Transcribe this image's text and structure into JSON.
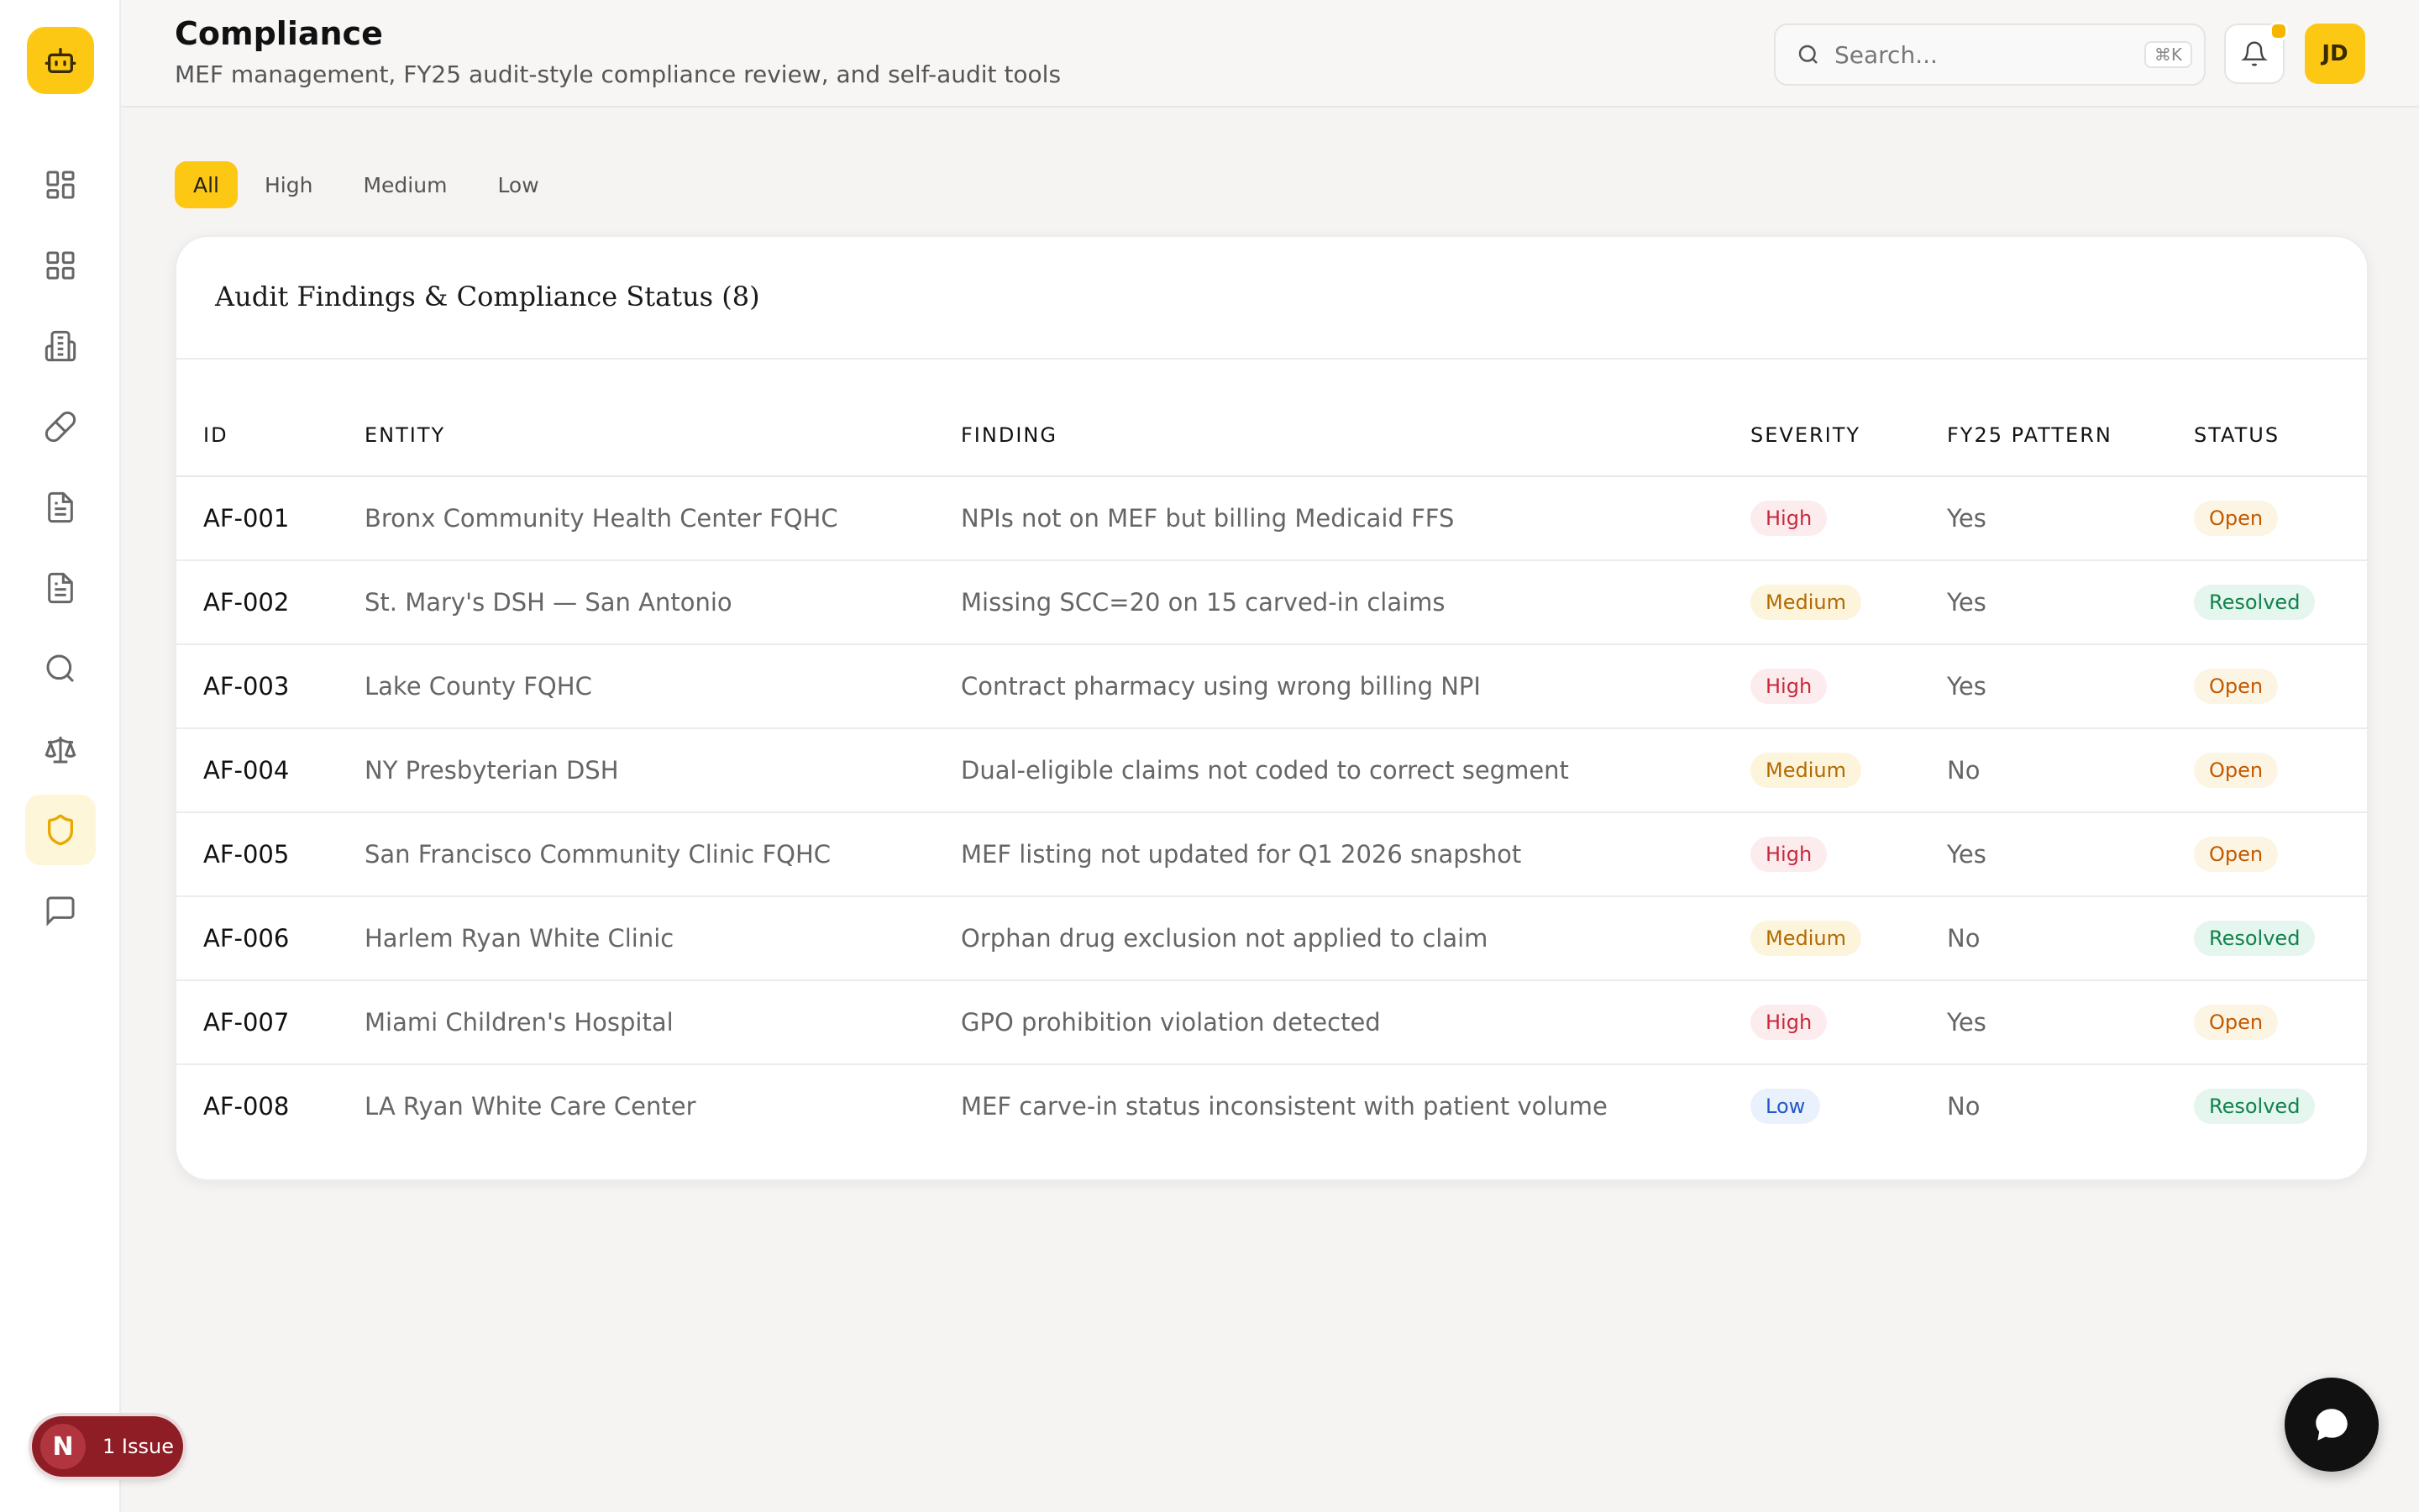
{
  "header": {
    "title": "Compliance",
    "subtitle": "MEF management, FY25 audit-style compliance review, and self-audit tools",
    "search_placeholder": "Search...",
    "search_shortcut": "⌘K",
    "avatar_initials": "JD"
  },
  "sidebar": {
    "logo_icon": "robot-icon",
    "items": [
      {
        "icon": "dashboard-icon",
        "active": false
      },
      {
        "icon": "grid-icon",
        "active": false
      },
      {
        "icon": "building-icon",
        "active": false
      },
      {
        "icon": "pill-icon",
        "active": false
      },
      {
        "icon": "document-icon",
        "active": false
      },
      {
        "icon": "document-icon",
        "active": false
      },
      {
        "icon": "search-icon",
        "active": false
      },
      {
        "icon": "scale-icon",
        "active": false
      },
      {
        "icon": "shield-icon",
        "active": true
      },
      {
        "icon": "chat-icon",
        "active": false
      }
    ]
  },
  "filters": {
    "all": "All",
    "high": "High",
    "medium": "Medium",
    "low": "Low",
    "selected": "All"
  },
  "card": {
    "title": "Audit Findings & Compliance Status (8)"
  },
  "table": {
    "headers": {
      "id": "ID",
      "entity": "ENTITY",
      "finding": "FINDING",
      "severity": "SEVERITY",
      "fy25": "FY25 PATTERN",
      "status": "STATUS"
    },
    "rows": [
      {
        "id": "AF-001",
        "entity": "Bronx Community Health Center FQHC",
        "finding": "NPIs not on MEF but billing Medicaid FFS",
        "severity": "High",
        "fy25": "Yes",
        "status": "Open"
      },
      {
        "id": "AF-002",
        "entity": "St. Mary's DSH — San Antonio",
        "finding": "Missing SCC=20 on 15 carved-in claims",
        "severity": "Medium",
        "fy25": "Yes",
        "status": "Resolved"
      },
      {
        "id": "AF-003",
        "entity": "Lake County FQHC",
        "finding": "Contract pharmacy using wrong billing NPI",
        "severity": "High",
        "fy25": "Yes",
        "status": "Open"
      },
      {
        "id": "AF-004",
        "entity": "NY Presbyterian DSH",
        "finding": "Dual-eligible claims not coded to correct segment",
        "severity": "Medium",
        "fy25": "No",
        "status": "Open"
      },
      {
        "id": "AF-005",
        "entity": "San Francisco Community Clinic FQHC",
        "finding": "MEF listing not updated for Q1 2026 snapshot",
        "severity": "High",
        "fy25": "Yes",
        "status": "Open"
      },
      {
        "id": "AF-006",
        "entity": "Harlem Ryan White Clinic",
        "finding": "Orphan drug exclusion not applied to claim",
        "severity": "Medium",
        "fy25": "No",
        "status": "Resolved"
      },
      {
        "id": "AF-007",
        "entity": "Miami Children's Hospital",
        "finding": "GPO prohibition violation detected",
        "severity": "High",
        "fy25": "Yes",
        "status": "Open"
      },
      {
        "id": "AF-008",
        "entity": "LA Ryan White Care Center",
        "finding": "MEF carve-in status inconsistent with patient volume",
        "severity": "Low",
        "fy25": "No",
        "status": "Resolved"
      }
    ]
  },
  "dev_badge": {
    "letter": "N",
    "label": "1 Issue"
  },
  "colors": {
    "accent": "#fcc813",
    "high": "#c8283a",
    "medium": "#b26a00",
    "low": "#2358c4",
    "open": "#c15a00",
    "resolved": "#11824d"
  }
}
